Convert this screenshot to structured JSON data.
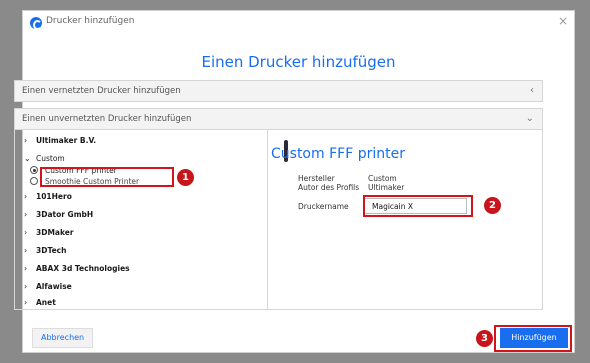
{
  "window": {
    "title": "Drucker hinzufügen",
    "close_glyph": "×",
    "logo_icon": "cura-logo-icon"
  },
  "heading": "Einen Drucker hinzufügen",
  "accordions": {
    "networked": {
      "label": "Einen vernetzten Drucker hinzufügen",
      "arrow": "‹"
    },
    "local": {
      "label": "Einen unvernetzten Drucker hinzufügen",
      "arrow": "⌄"
    }
  },
  "tree": {
    "items": [
      {
        "label": "Ultimaker B.V.",
        "chev": "›"
      },
      {
        "label": "Custom",
        "chev": "⌄"
      },
      {
        "label": "101Hero",
        "chev": "›"
      },
      {
        "label": "3Dator GmbH",
        "chev": "›"
      },
      {
        "label": "3DMaker",
        "chev": "›"
      },
      {
        "label": "3DTech",
        "chev": "›"
      },
      {
        "label": "ABAX 3d Technologies",
        "chev": "›"
      },
      {
        "label": "Alfawise",
        "chev": "›"
      },
      {
        "label": "Anet",
        "chev": "›"
      }
    ],
    "custom_options": [
      {
        "label": "Custom FFF printer",
        "checked": true
      },
      {
        "label": "Smoothie Custom Printer",
        "checked": false
      }
    ]
  },
  "details": {
    "printer_name": "Custom FFF printer",
    "manufacturer_label": "Hersteller",
    "manufacturer_value": "Custom",
    "author_label": "Autor des Profils",
    "author_value": "Ultimaker",
    "name_label": "Druckername",
    "name_value": "Magicain X"
  },
  "buttons": {
    "cancel": "Abbrechen",
    "add": "Hinzufügen"
  },
  "annotations": {
    "step1": "1",
    "step2": "2",
    "step3": "3",
    "color": "#d3141b"
  },
  "colors": {
    "accent": "#196ef0"
  }
}
